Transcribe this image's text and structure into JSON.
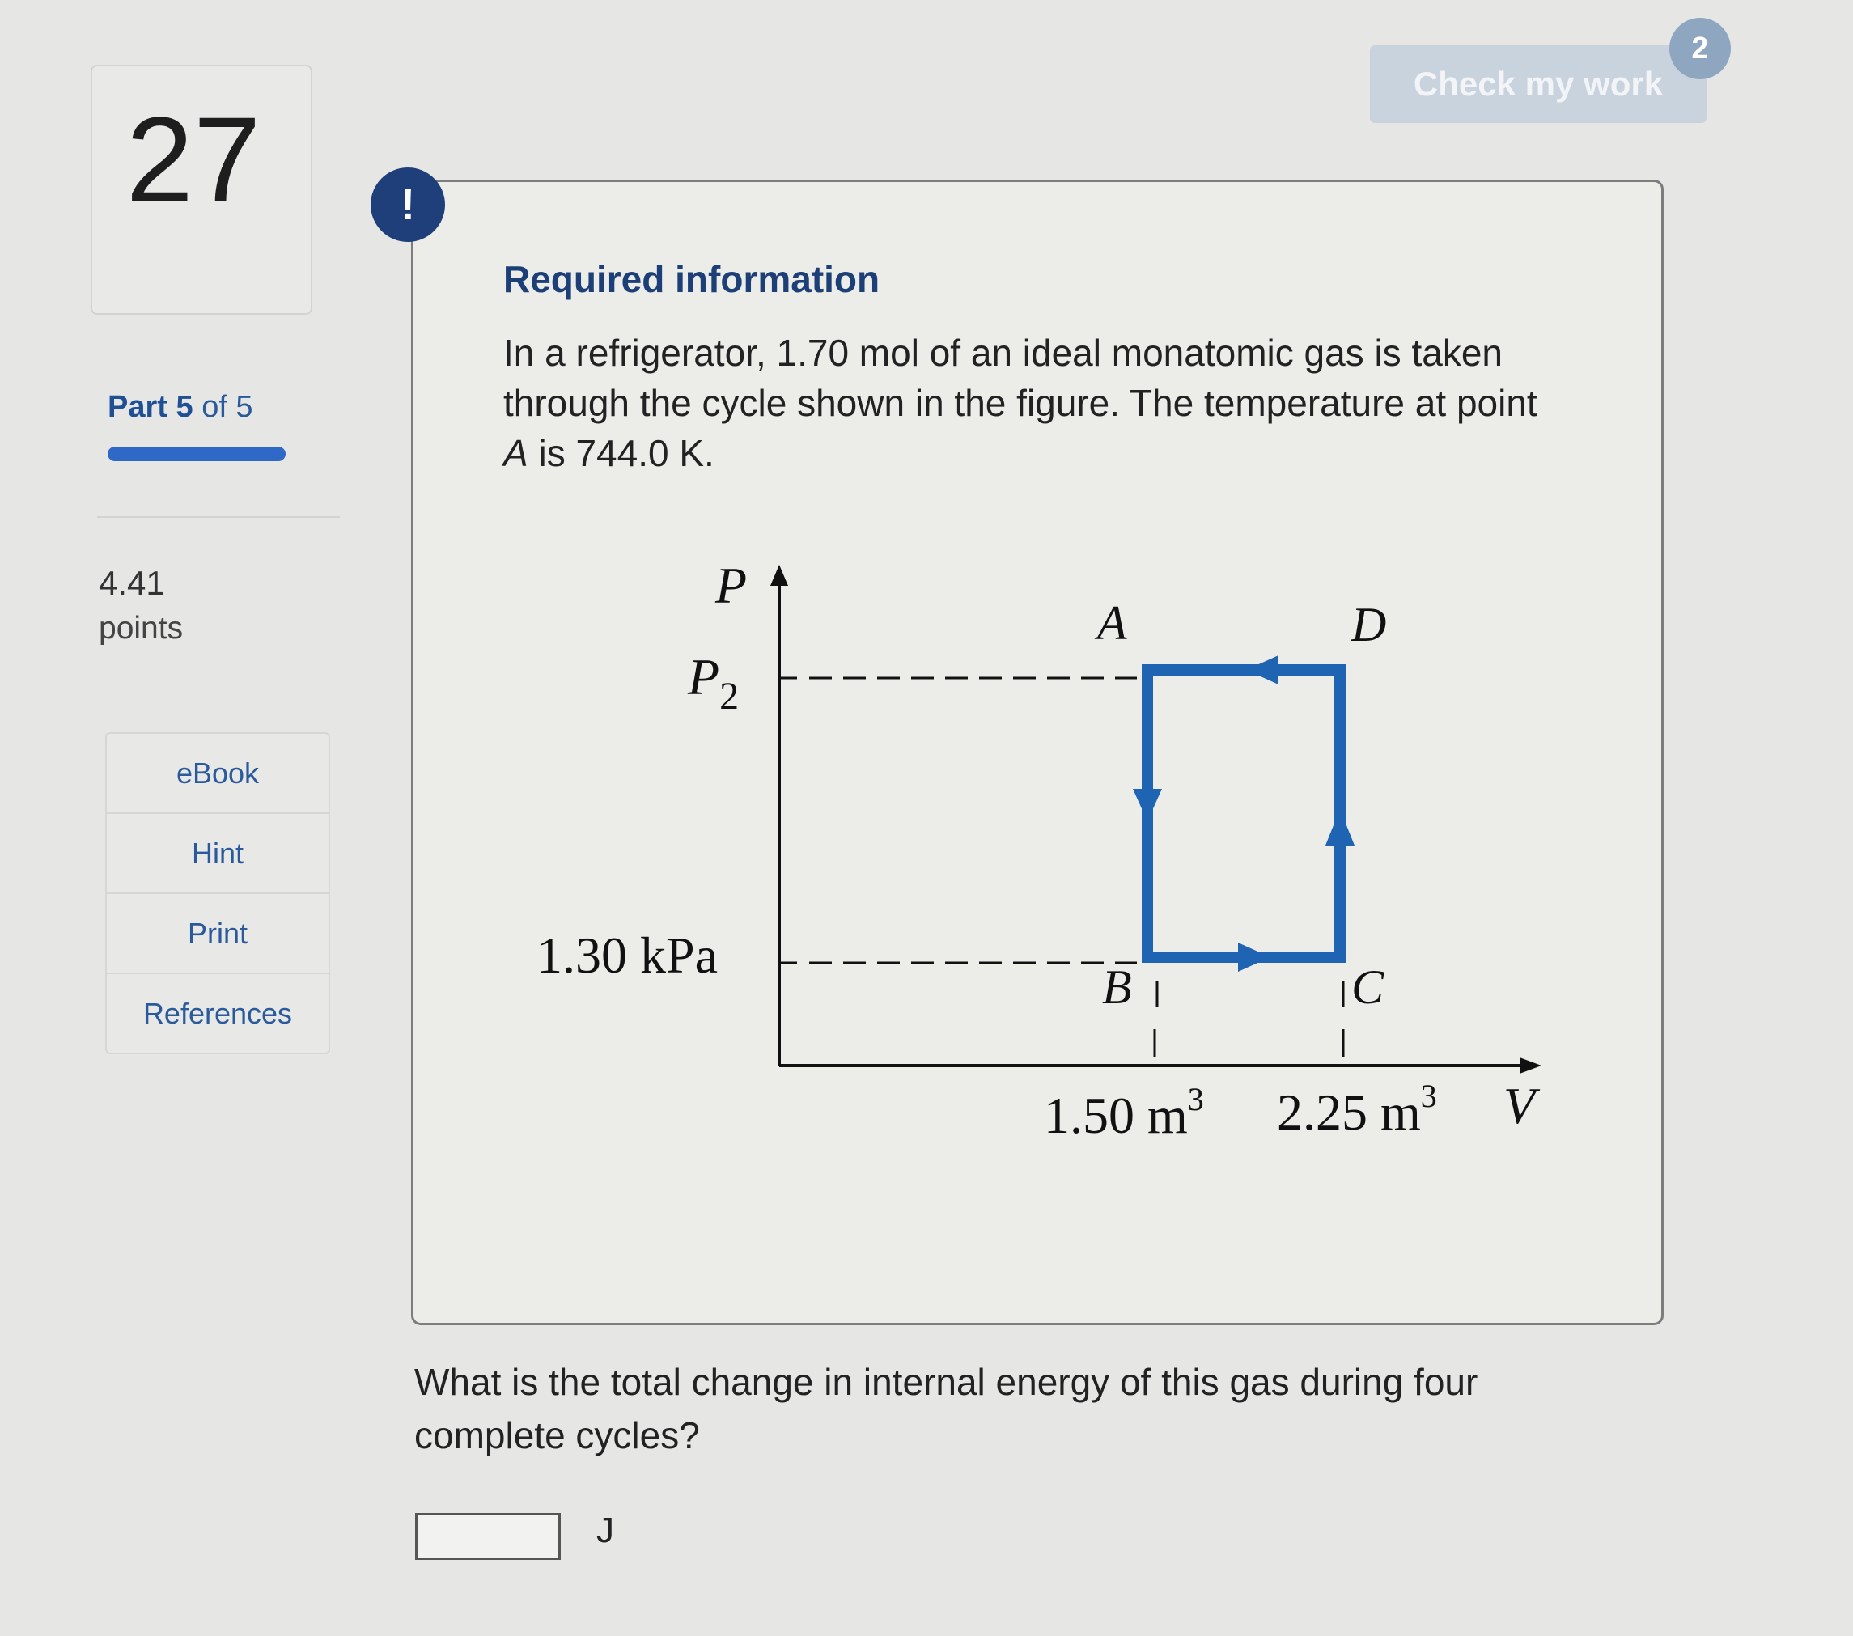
{
  "question_number": "27",
  "part": {
    "prefix": "Part",
    "current": "5",
    "suffix": "of 5",
    "progress": 1.0
  },
  "points": {
    "value": "4.41",
    "label": "points"
  },
  "tools": [
    "eBook",
    "Hint",
    "Print",
    "References"
  ],
  "check_button": {
    "label": "Check my work",
    "badge": "2"
  },
  "info": {
    "alert_glyph": "!",
    "title": "Required information",
    "text_before": "In a refrigerator, 1.70 mol of an ideal monatomic gas is taken through the cycle shown in the figure. The temperature at point ",
    "text_point": "A",
    "text_after": " is 744.0 K."
  },
  "figure": {
    "p_axis": "P",
    "p2_main": "P",
    "p2_sub": "2",
    "p_low": "1.30 kPa",
    "v_axis": "V",
    "v1": "1.50 m",
    "v1_exp": "3",
    "v2": "2.25 m",
    "v2_exp": "3",
    "point_a": "A",
    "point_b": "B",
    "point_c": "C",
    "point_d": "D",
    "cycle_color": "#1f63b3"
  },
  "question": {
    "text": "What is the total change in internal energy of this gas during four complete cycles?",
    "answer_value": "",
    "unit": "J"
  }
}
